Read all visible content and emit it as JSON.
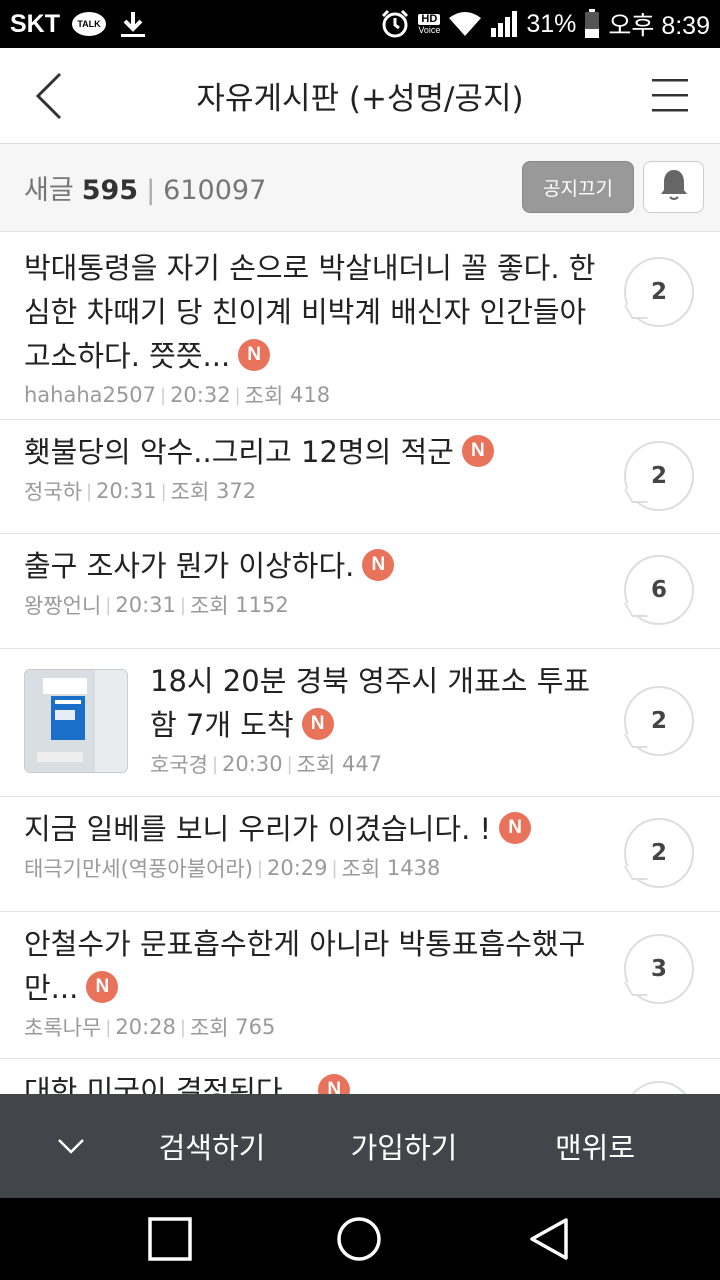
{
  "status_bar": {
    "carrier": "SKT",
    "talk_label": "TALK",
    "hd_label": "HD",
    "voice_label": "Voice",
    "battery": "31%",
    "time": "오후 8:39"
  },
  "header": {
    "title": "자유게시판 (+성명/공지)"
  },
  "subheader": {
    "new_label": "새글",
    "new_count": "595",
    "separator": "|",
    "total_count": "610097",
    "notice_button": "공지끄기"
  },
  "posts": [
    {
      "title": "박대통령을 자기 손으로 박살내더니 꼴 좋다. 한심한 차때기 당 친이계 비박계 배신자 인간들아 고소하다. 쯧쯧...",
      "badge": "N",
      "author": "hahaha2507",
      "time": "20:32",
      "views_label": "조회",
      "views": "418",
      "comments": "2"
    },
    {
      "title": "횃불당의 악수..그리고 12명의 적군",
      "badge": "N",
      "author": "정국하",
      "time": "20:31",
      "views_label": "조회",
      "views": "372",
      "comments": "2"
    },
    {
      "title": "출구 조사가 뭔가 이상하다.",
      "badge": "N",
      "author": "왕짱언니",
      "time": "20:31",
      "views_label": "조회",
      "views": "1152",
      "comments": "6"
    },
    {
      "title": "18시 20분 경북 영주시 개표소 투표함 7개 도착",
      "badge": "N",
      "author": "호국경",
      "time": "20:30",
      "views_label": "조회",
      "views": "447",
      "comments": "2",
      "thumbnail": true
    },
    {
      "title": "지금 일베를 보니 우리가 이겼습니다. !",
      "badge": "N",
      "author": "태극기만세(역풍아불어라)",
      "time": "20:29",
      "views_label": "조회",
      "views": "1438",
      "comments": "2"
    },
    {
      "title": "안철수가 문표흡수한게 아니라 박통표흡수했구만...",
      "badge": "N",
      "author": "초록나무",
      "time": "20:28",
      "views_label": "조회",
      "views": "765",
      "comments": "3"
    },
    {
      "title": "대한 미국이 결정된다...",
      "badge": "N"
    }
  ],
  "toolbar": {
    "search": "검색하기",
    "join": "가입하기",
    "top": "맨위로"
  },
  "colors": {
    "badge": "#e8735a",
    "toolbar": "#424549",
    "notice_button": "#999999"
  }
}
